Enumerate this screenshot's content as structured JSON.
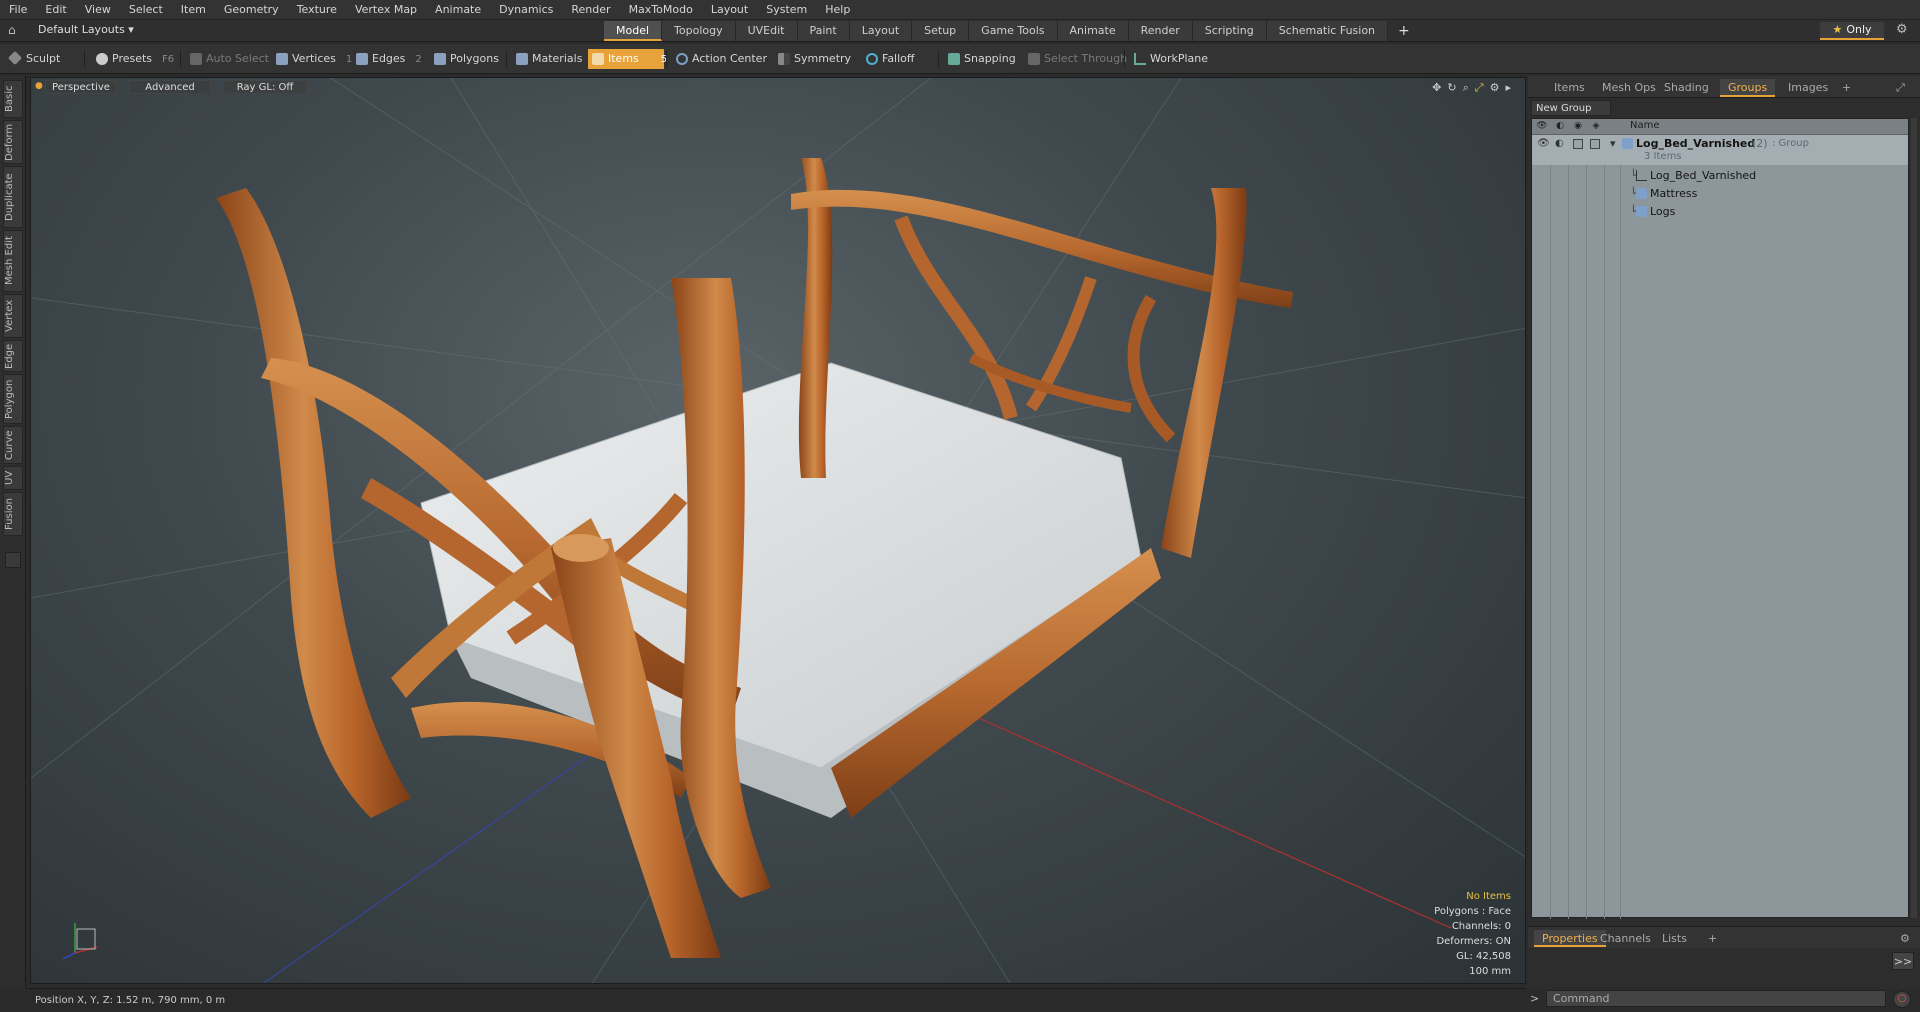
{
  "menu": [
    "File",
    "Edit",
    "View",
    "Select",
    "Item",
    "Geometry",
    "Texture",
    "Vertex Map",
    "Animate",
    "Dynamics",
    "Render",
    "MaxToModo",
    "Layout",
    "System",
    "Help"
  ],
  "layoutbar": {
    "layouts_label": "Default Layouts ▾",
    "tabs": [
      "Model",
      "Topology",
      "UVEdit",
      "Paint",
      "Layout",
      "Setup",
      "Game Tools",
      "Animate",
      "Render",
      "Scripting",
      "Schematic Fusion"
    ],
    "active_tab": "Model",
    "plus": "+",
    "only_label": "Only"
  },
  "toolbar": {
    "sculpt": "Sculpt",
    "presets": "Presets",
    "presets_key": "F6",
    "auto_select": "Auto Select",
    "vertices": "Vertices",
    "vertices_key": "1",
    "edges": "Edges",
    "edges_key": "2",
    "polygons": "Polygons",
    "materials": "Materials",
    "items": "Items",
    "items_key": "5",
    "action_center": "Action Center",
    "symmetry": "Symmetry",
    "falloff": "Falloff",
    "snapping": "Snapping",
    "select_through": "Select Through",
    "workplane": "WorkPlane"
  },
  "left_tabs": [
    "Basic",
    "Deform",
    "Duplicate",
    "Mesh Edit",
    "Vertex",
    "Edge",
    "Polygon",
    "Curve",
    "UV",
    "Fusion"
  ],
  "viewport": {
    "perspective": "Perspective",
    "advanced": "Advanced",
    "raygl": "Ray GL: Off",
    "info": {
      "selection": "No Items",
      "polygons": "Polygons : Face",
      "channels": "Channels: 0",
      "deformers": "Deformers: ON",
      "gl": "GL: 42,508",
      "scale": "100 mm"
    }
  },
  "status": {
    "position": "Position X, Y, Z:   1.52 m, 790 mm, 0 m"
  },
  "right_panel": {
    "tabs": [
      "Items",
      "Mesh Ops",
      "Shading",
      "Groups",
      "Images"
    ],
    "active_tab": "Groups",
    "plus": "+",
    "new_group": "New Group",
    "name_col": "Name",
    "group": {
      "name": "Log_Bed_Varnished",
      "count": "(2)",
      "type": ": Group",
      "items_count": "3 Items"
    },
    "children": [
      "Log_Bed_Varnished",
      "Mattress",
      "Logs"
    ]
  },
  "bottom_panel": {
    "tabs": [
      "Properties",
      "Channels",
      "Lists"
    ],
    "active_tab": "Properties",
    "plus": "+",
    "expand": ">>",
    "command_placeholder": "Command"
  },
  "colors": {
    "accent": "#e8a23a",
    "wood": "#b8652a",
    "mattress": "#d9dcdd"
  }
}
